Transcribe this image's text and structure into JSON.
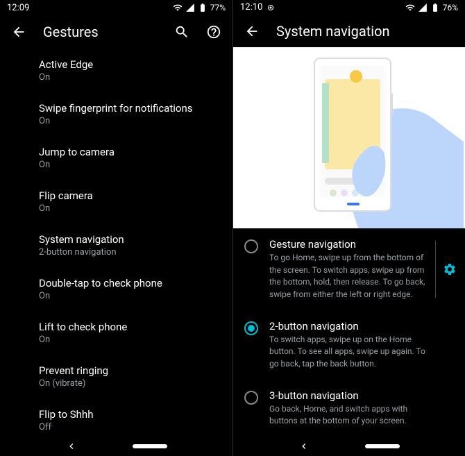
{
  "left": {
    "status": {
      "time": "12:09",
      "battery": "77%"
    },
    "title": "Gestures",
    "items": [
      {
        "title": "Active Edge",
        "sub": "On"
      },
      {
        "title": "Swipe fingerprint for notifications",
        "sub": "On"
      },
      {
        "title": "Jump to camera",
        "sub": "On"
      },
      {
        "title": "Flip camera",
        "sub": "On"
      },
      {
        "title": "System navigation",
        "sub": "2-button navigation"
      },
      {
        "title": "Double-tap to check phone",
        "sub": "On"
      },
      {
        "title": "Lift to check phone",
        "sub": "On"
      },
      {
        "title": "Prevent ringing",
        "sub": "On (vibrate)"
      },
      {
        "title": "Flip to Shhh",
        "sub": "Off"
      }
    ]
  },
  "right": {
    "status": {
      "time": "12:10",
      "battery": "76%"
    },
    "title": "System navigation",
    "options": [
      {
        "title": "Gesture navigation",
        "desc": "To go Home, swipe up from the bottom of the screen. To switch apps, swipe up from the bottom, hold, then release. To go back, swipe from either the left or right edge.",
        "selected": false,
        "gear": true
      },
      {
        "title": "2-button navigation",
        "desc": "To switch apps, swipe up on the Home button. To see all apps, swipe up again. To go back, tap the back button.",
        "selected": true,
        "gear": false
      },
      {
        "title": "3-button navigation",
        "desc": "Go back, Home, and switch apps with buttons at the bottom of your screen.",
        "selected": false,
        "gear": false
      }
    ]
  }
}
